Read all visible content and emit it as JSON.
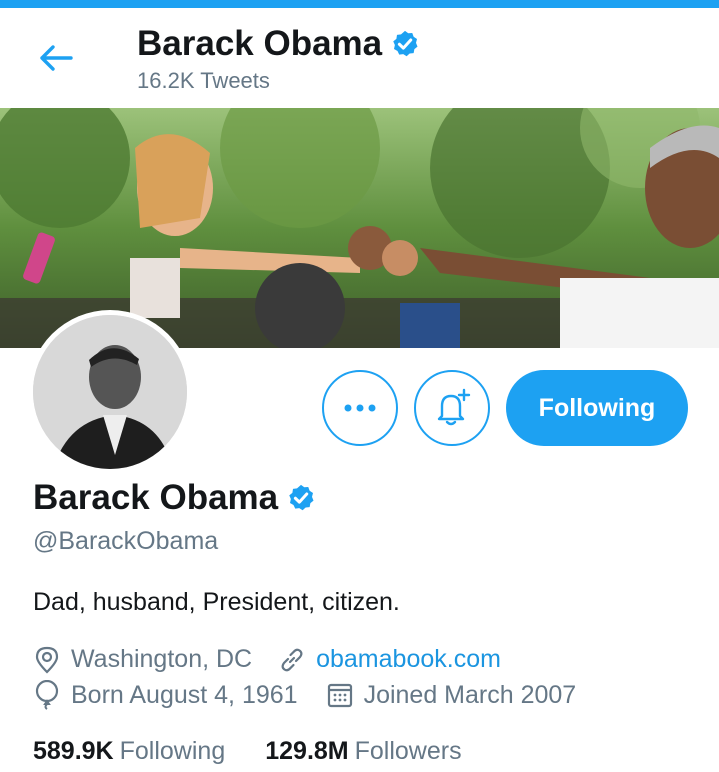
{
  "header": {
    "title": "Barack Obama",
    "tweet_count": "16.2K Tweets"
  },
  "profile": {
    "name": "Barack Obama",
    "handle": "@BarackObama",
    "bio": "Dad, husband, President, citizen.",
    "location": "Washington, DC",
    "website": "obamabook.com",
    "birthday": "Born August 4, 1961",
    "joined": "Joined March 2007",
    "following_count": "589.9K",
    "following_label": "Following",
    "followers_count": "129.8M",
    "followers_label": "Followers"
  },
  "actions": {
    "follow_state_label": "Following"
  },
  "colors": {
    "accent": "#1da1f2",
    "link": "#1b95e0",
    "secondary_text": "#657786",
    "primary_text": "#14171a"
  },
  "icons": [
    "back-arrow-icon",
    "verified-badge-icon",
    "more-dots-icon",
    "bell-plus-icon",
    "location-pin-icon",
    "link-icon",
    "balloon-icon",
    "calendar-icon"
  ]
}
